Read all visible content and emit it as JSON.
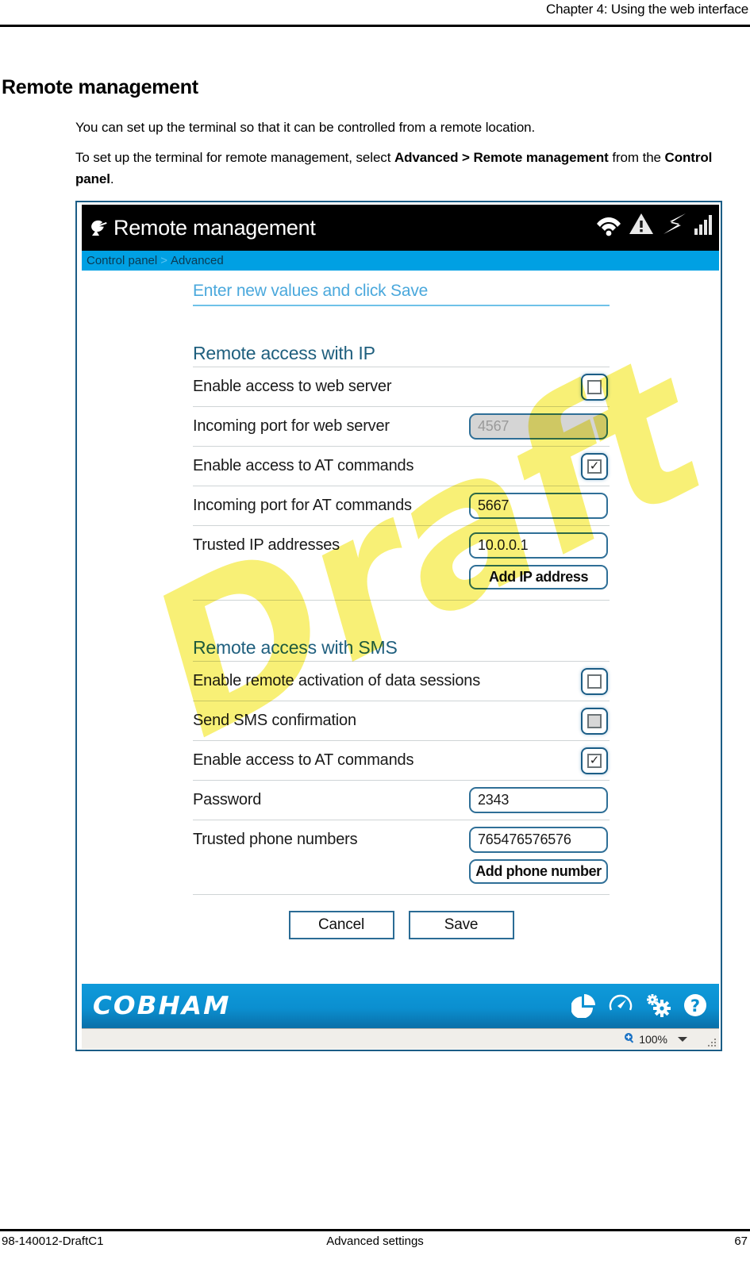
{
  "page": {
    "header_title": "Chapter 4: Using the web interface",
    "footer_left": "98-140012-DraftC1",
    "footer_center": "Advanced settings",
    "footer_right": "67",
    "doc_title": "Remote management",
    "paragraph_1": "You can set up the terminal so that it can be controlled from a remote location.",
    "paragraph_2_a": "To set up the terminal for remote management, select ",
    "paragraph_2_b": "Advanced > Remote management",
    "paragraph_2_c": " from the ",
    "paragraph_2_d": "Control panel",
    "paragraph_2_e": ".",
    "watermark": "Draft"
  },
  "figure": {
    "titlebar": {
      "icon": "satellite-dish-icon",
      "title": "Remote management",
      "status_icons": [
        "wifi-icon",
        "warning-icon",
        "satellite-link-icon",
        "signal-bars-icon"
      ]
    },
    "breadcrumb": {
      "root": "Control panel",
      "separator": ">",
      "current": "Advanced"
    },
    "intro_heading": "Enter new values and click Save",
    "sections": [
      {
        "heading": "Remote access with IP",
        "rows": [
          {
            "label": "Enable access to web server",
            "control": "checkbox",
            "checked": false,
            "disabled": false
          },
          {
            "label": "Incoming port for web server",
            "control": "text",
            "value": "4567",
            "disabled": true
          },
          {
            "label": "Enable access to AT commands",
            "control": "checkbox",
            "checked": true,
            "disabled": false
          },
          {
            "label": "Incoming port for AT commands",
            "control": "text",
            "value": "5667",
            "disabled": false
          },
          {
            "label": "Trusted IP addresses",
            "control": "text",
            "value": "10.0.0.1",
            "disabled": false
          }
        ],
        "add_button": "Add IP address"
      },
      {
        "heading": "Remote access with SMS",
        "rows": [
          {
            "label": "Enable remote activation of data sessions",
            "control": "checkbox",
            "checked": false,
            "disabled": false
          },
          {
            "label": "Send SMS confirmation",
            "control": "checkbox",
            "checked": false,
            "disabled": true
          },
          {
            "label": "Enable access to AT commands",
            "control": "checkbox",
            "checked": true,
            "disabled": false
          },
          {
            "label": "Password",
            "control": "text",
            "value": "2343",
            "disabled": false
          },
          {
            "label": "Trusted phone numbers",
            "control": "text",
            "value": "765476576576",
            "disabled": false
          }
        ],
        "add_button": "Add phone number"
      }
    ],
    "actions": {
      "cancel": "Cancel",
      "save": "Save"
    },
    "footer": {
      "brand": "COBHAM",
      "icons": [
        "pie-chart-icon",
        "gauge-icon",
        "settings-gears-icon",
        "help-icon"
      ]
    },
    "statusbar": {
      "zoom_icon": "zoom-magnifier-icon",
      "zoom_level": "100%"
    },
    "colors": {
      "accent_blue": "#00a0e3",
      "heading_blue": "#1f5f7e",
      "intro_blue": "#4aa8dc",
      "footer_blue": "#0b8fd0",
      "watermark_yellow": "#f6ec4f",
      "titlebar_black": "#000000"
    }
  }
}
